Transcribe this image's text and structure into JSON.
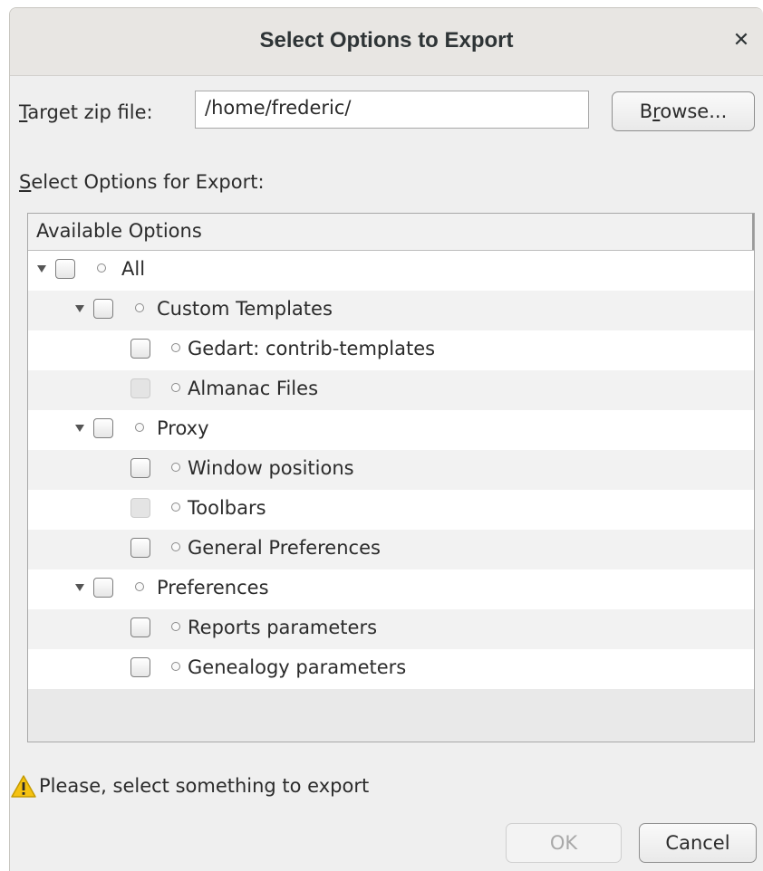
{
  "window": {
    "title": "Select Options to Export",
    "close_glyph": "✕"
  },
  "target": {
    "label_mnemonic": "T",
    "label_rest": "arget zip file:",
    "value": "/home/frederic/",
    "browse_pre": "B",
    "browse_mnemonic": "r",
    "browse_post": "owse..."
  },
  "options": {
    "label_mnemonic": "S",
    "label_rest": "elect Options for Export:",
    "column_header": "Available Options",
    "rows": [
      {
        "label": "All",
        "level": 0,
        "expanded": true,
        "enabled": true
      },
      {
        "label": "Custom Templates",
        "level": 1,
        "expanded": true,
        "enabled": true
      },
      {
        "label": "Gedart: contrib-templates",
        "level": 2,
        "enabled": true
      },
      {
        "label": "Almanac Files",
        "level": 2,
        "enabled": false
      },
      {
        "label": "Proxy",
        "level": 1,
        "expanded": true,
        "enabled": true
      },
      {
        "label": "Window positions",
        "level": 2,
        "enabled": true
      },
      {
        "label": "Toolbars",
        "level": 2,
        "enabled": false
      },
      {
        "label": "General Preferences",
        "level": 2,
        "enabled": true
      },
      {
        "label": "Preferences",
        "level": 1,
        "expanded": true,
        "enabled": true
      },
      {
        "label": "Reports parameters",
        "level": 2,
        "enabled": true
      },
      {
        "label": "Genealogy parameters",
        "level": 2,
        "enabled": true
      }
    ]
  },
  "status": {
    "icon": "warning-icon",
    "message": "Please, select something to export"
  },
  "buttons": {
    "ok": "OK",
    "cancel": "Cancel"
  },
  "colors": {
    "warning": "#f5c211",
    "disabled_text": "#a8a8a8"
  }
}
